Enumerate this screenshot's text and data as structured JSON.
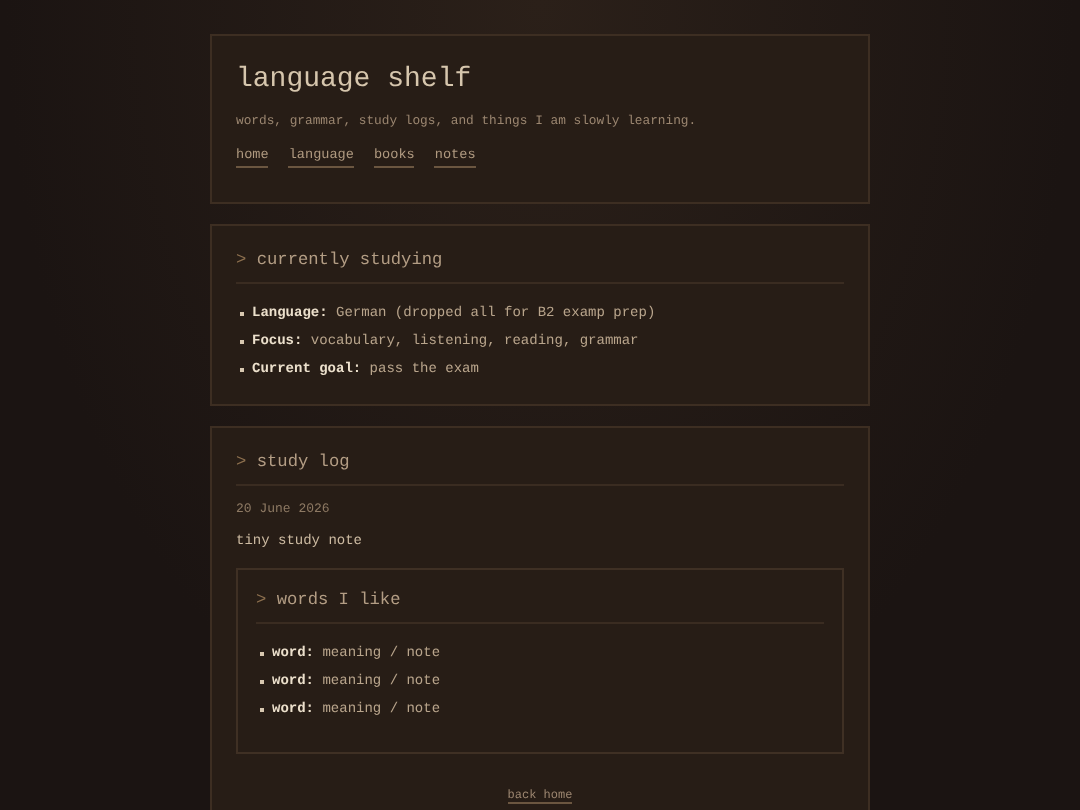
{
  "header": {
    "title": "language shelf",
    "tagline": "words, grammar, study logs, and things I am slowly learning.",
    "nav": [
      {
        "label": "home"
      },
      {
        "label": "language"
      },
      {
        "label": "books"
      },
      {
        "label": "notes"
      }
    ]
  },
  "studying": {
    "prompt": ">",
    "heading": "currently studying",
    "items": [
      {
        "term": "Language:",
        "text": "German (dropped all for B2 examp prep)"
      },
      {
        "term": "Focus:",
        "text": "vocabulary, listening, reading, grammar"
      },
      {
        "term": "Current goal:",
        "text": "pass the exam"
      }
    ]
  },
  "log": {
    "prompt": ">",
    "heading": "study log",
    "date": "20 June 2026",
    "note": "tiny study note",
    "words": {
      "prompt": ">",
      "heading": "words I like",
      "items": [
        {
          "term": "word:",
          "text": "meaning / note"
        },
        {
          "term": "word:",
          "text": "meaning / note"
        },
        {
          "term": "word:",
          "text": "meaning / note"
        }
      ]
    }
  },
  "footer_link": "back home"
}
